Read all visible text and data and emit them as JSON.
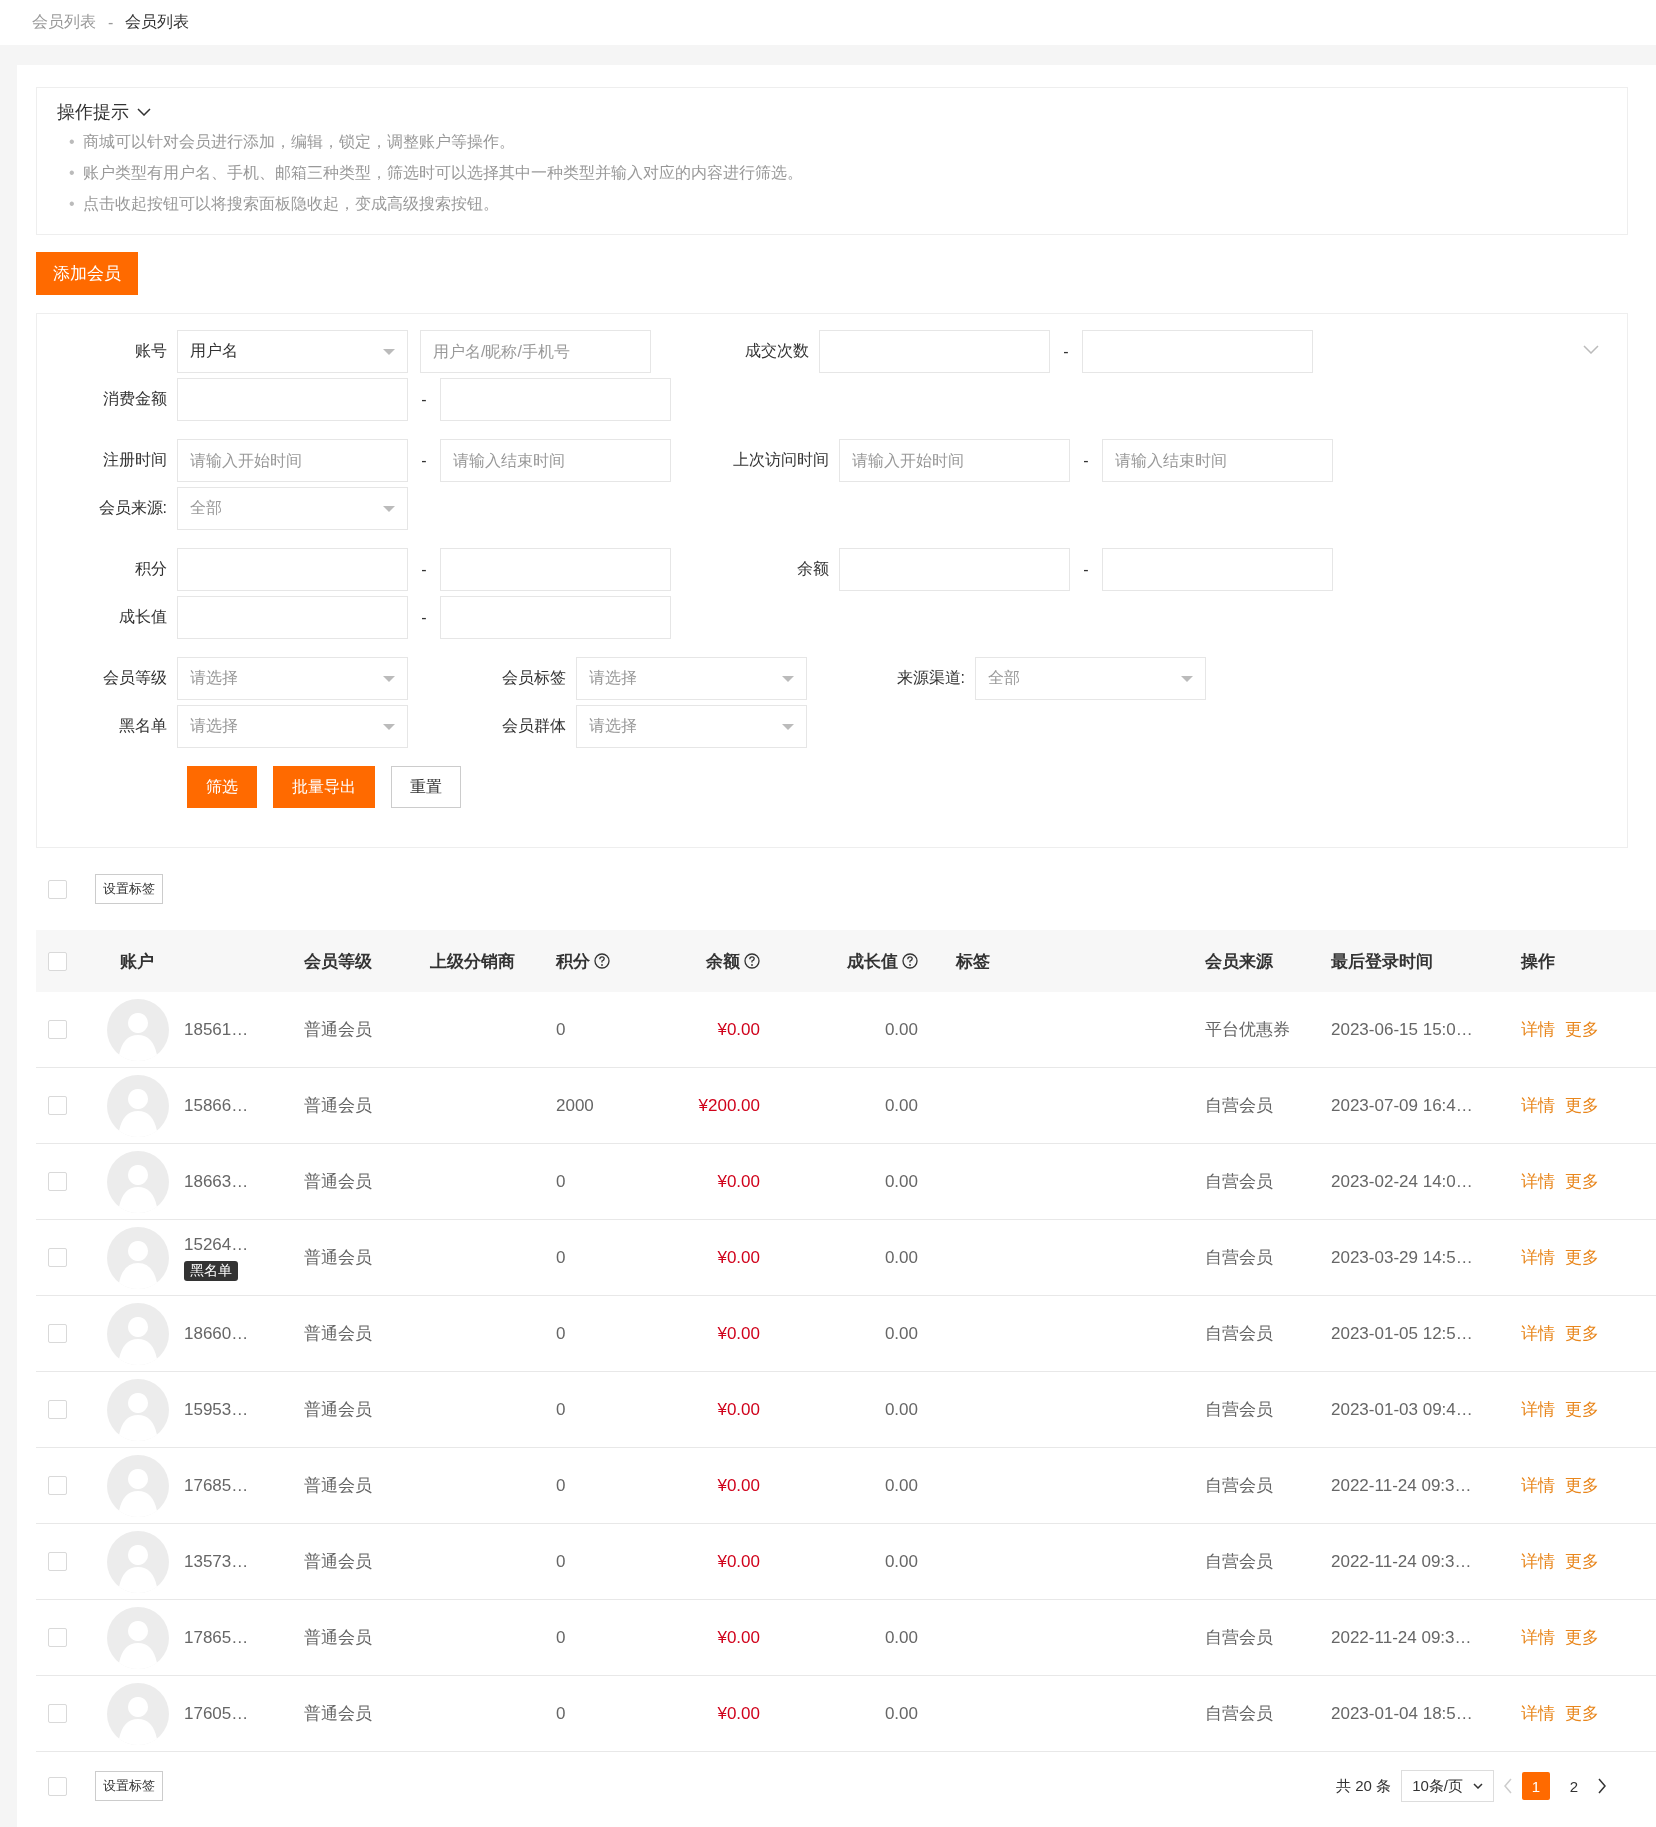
{
  "breadcrumb": {
    "items": [
      "会员列表",
      "会员列表"
    ],
    "separator": "-"
  },
  "tips": {
    "title": "操作提示",
    "expanded": true,
    "bullet": "•",
    "items": [
      "商城可以针对会员进行添加，编辑，锁定，调整账户等操作。",
      "账户类型有用户名、手机、邮箱三种类型，筛选时可以选择其中一种类型并输入对应的内容进行筛选。",
      "点击收起按钮可以将搜索面板隐收起，变成高级搜索按钮。"
    ]
  },
  "add_button": "添加会员",
  "filter": {
    "expanded": true,
    "groups": [
      {
        "lines": [
          [
            {
              "label": "账号",
              "controls": [
                {
                  "kind": "select",
                  "value": "用户名"
                },
                {
                  "kind": "input",
                  "placeholder": "用户名/昵称/手机号"
                }
              ]
            },
            {
              "label": "成交次数",
              "separator": "-",
              "controls": [
                {
                  "kind": "input"
                },
                {
                  "kind": "input"
                }
              ]
            }
          ],
          [
            {
              "label": "消费金额",
              "separator": "-",
              "controls": [
                {
                  "kind": "input"
                },
                {
                  "kind": "input"
                }
              ]
            }
          ]
        ]
      },
      {
        "lines": [
          [
            {
              "label": "注册时间",
              "separator": "-",
              "controls": [
                {
                  "kind": "input",
                  "placeholder": "请输入开始时间"
                },
                {
                  "kind": "input",
                  "placeholder": "请输入结束时间"
                }
              ]
            },
            {
              "label": "上次访问时间",
              "separator": "-",
              "controls": [
                {
                  "kind": "input",
                  "placeholder": "请输入开始时间"
                },
                {
                  "kind": "input",
                  "placeholder": "请输入结束时间"
                }
              ]
            }
          ],
          [
            {
              "label": "会员来源:",
              "controls": [
                {
                  "kind": "select",
                  "placeholder": "全部"
                }
              ]
            }
          ]
        ]
      },
      {
        "lines": [
          [
            {
              "label": "积分",
              "separator": "-",
              "controls": [
                {
                  "kind": "input"
                },
                {
                  "kind": "input"
                }
              ]
            },
            {
              "label": "余额",
              "separator": "-",
              "controls": [
                {
                  "kind": "input"
                },
                {
                  "kind": "input"
                }
              ]
            }
          ],
          [
            {
              "label": "成长值",
              "separator": "-",
              "controls": [
                {
                  "kind": "input"
                },
                {
                  "kind": "input"
                }
              ]
            }
          ]
        ]
      },
      {
        "lines": [
          [
            {
              "label": "会员等级",
              "controls": [
                {
                  "kind": "select",
                  "placeholder": "请选择"
                }
              ]
            },
            {
              "label": "会员标签",
              "controls": [
                {
                  "kind": "select",
                  "placeholder": "请选择"
                }
              ]
            },
            {
              "label": "来源渠道:",
              "controls": [
                {
                  "kind": "select",
                  "placeholder": "全部"
                }
              ]
            }
          ],
          [
            {
              "label": "黑名单",
              "controls": [
                {
                  "kind": "select",
                  "placeholder": "请选择"
                }
              ]
            },
            {
              "label": "会员群体",
              "controls": [
                {
                  "kind": "select",
                  "placeholder": "请选择"
                }
              ]
            }
          ]
        ]
      }
    ],
    "buttons": [
      {
        "label": "筛选",
        "kind": "primary"
      },
      {
        "label": "批量导出",
        "kind": "primary"
      },
      {
        "label": "重置",
        "kind": "default"
      }
    ]
  },
  "bulk_top": {
    "checked": false,
    "button": "设置标签"
  },
  "table": {
    "columns": [
      {
        "label": "账户"
      },
      {
        "label": "会员等级"
      },
      {
        "label": "上级分销商"
      },
      {
        "label": "积分",
        "help": true
      },
      {
        "label": "余额",
        "help": true
      },
      {
        "label": "成长值",
        "help": true
      },
      {
        "label": "标签"
      },
      {
        "label": "会员来源"
      },
      {
        "label": "最后登录时间"
      },
      {
        "label": "操作"
      }
    ],
    "header_checked": false,
    "rows": [
      {
        "checked": false,
        "account": "18561…",
        "level": "普通会员",
        "points": "0",
        "balance": "¥0.00",
        "growth": "0.00",
        "source": "平台优惠券",
        "last_login": "2023-06-15 15:0…",
        "actions": [
          "详情",
          "更多"
        ]
      },
      {
        "checked": false,
        "account": "15866…",
        "level": "普通会员",
        "points": "2000",
        "balance": "¥200.00",
        "growth": "0.00",
        "source": "自营会员",
        "last_login": "2023-07-09 16:4…",
        "actions": [
          "详情",
          "更多"
        ]
      },
      {
        "checked": false,
        "account": "18663…",
        "level": "普通会员",
        "points": "0",
        "balance": "¥0.00",
        "growth": "0.00",
        "source": "自营会员",
        "last_login": "2023-02-24 14:0…",
        "actions": [
          "详情",
          "更多"
        ]
      },
      {
        "checked": false,
        "account": "15264…",
        "badge": "黑名单",
        "level": "普通会员",
        "points": "0",
        "balance": "¥0.00",
        "growth": "0.00",
        "source": "自营会员",
        "last_login": "2023-03-29 14:5…",
        "actions": [
          "详情",
          "更多"
        ]
      },
      {
        "checked": false,
        "account": "18660…",
        "level": "普通会员",
        "points": "0",
        "balance": "¥0.00",
        "growth": "0.00",
        "source": "自营会员",
        "last_login": "2023-01-05 12:5…",
        "actions": [
          "详情",
          "更多"
        ]
      },
      {
        "checked": false,
        "account": "15953…",
        "level": "普通会员",
        "points": "0",
        "balance": "¥0.00",
        "growth": "0.00",
        "source": "自营会员",
        "last_login": "2023-01-03 09:4…",
        "actions": [
          "详情",
          "更多"
        ]
      },
      {
        "checked": false,
        "account": "17685…",
        "level": "普通会员",
        "points": "0",
        "balance": "¥0.00",
        "growth": "0.00",
        "source": "自营会员",
        "last_login": "2022-11-24 09:3…",
        "actions": [
          "详情",
          "更多"
        ]
      },
      {
        "checked": false,
        "account": "13573…",
        "level": "普通会员",
        "points": "0",
        "balance": "¥0.00",
        "growth": "0.00",
        "source": "自营会员",
        "last_login": "2022-11-24 09:3…",
        "actions": [
          "详情",
          "更多"
        ]
      },
      {
        "checked": false,
        "account": "17865…",
        "level": "普通会员",
        "points": "0",
        "balance": "¥0.00",
        "growth": "0.00",
        "source": "自营会员",
        "last_login": "2022-11-24 09:3…",
        "actions": [
          "详情",
          "更多"
        ]
      },
      {
        "checked": false,
        "account": "17605…",
        "level": "普通会员",
        "points": "0",
        "balance": "¥0.00",
        "growth": "0.00",
        "source": "自营会员",
        "last_login": "2023-01-04 18:5…",
        "actions": [
          "详情",
          "更多"
        ]
      }
    ]
  },
  "bulk_bottom": {
    "checked": false,
    "button": "设置标签"
  },
  "pager": {
    "total": "共 20 条",
    "page_size": "10条/页",
    "pages": [
      {
        "label": "1",
        "selected": true
      },
      {
        "label": "2",
        "selected": false
      }
    ]
  }
}
